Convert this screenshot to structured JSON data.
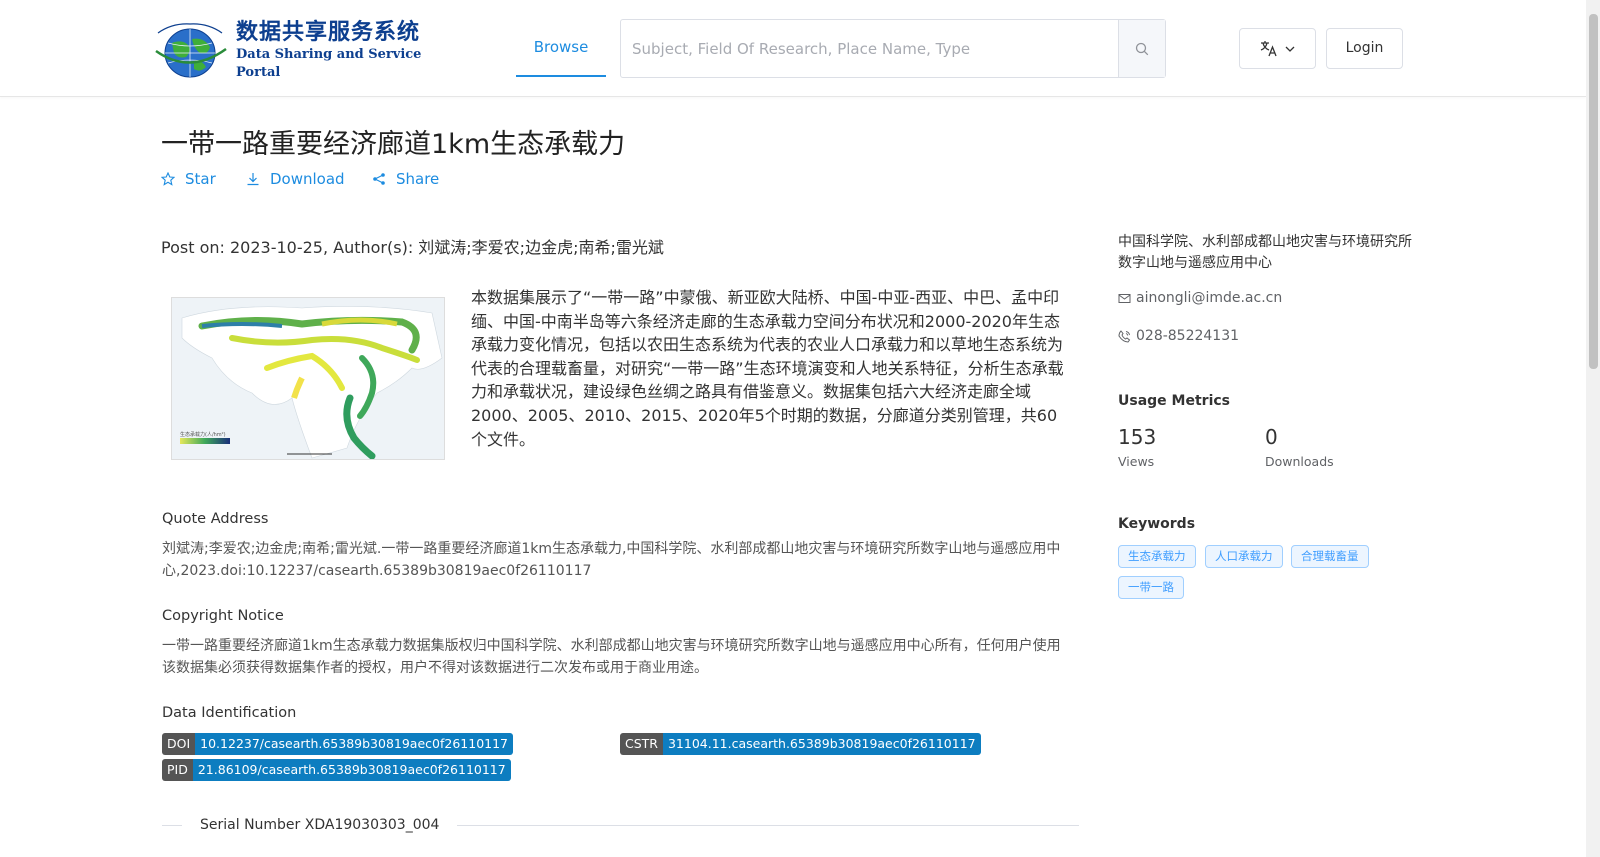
{
  "header": {
    "logo_cn": "数据共享服务系统",
    "logo_en": "Data Sharing and Service Portal",
    "nav_browse": "Browse",
    "search_placeholder": "Subject, Field Of Research, Place Name, Type",
    "login": "Login"
  },
  "dataset": {
    "title": "一带一路重要经济廊道1km生态承载力",
    "actions": {
      "star": "Star",
      "download": "Download",
      "share": "Share"
    },
    "post_meta": "Post on: 2023-10-25, Author(s): 刘斌涛;李爱农;边金虎;南希;雷光斌",
    "description": "本数据集展示了“一带一路”中蒙俄、新亚欧大陆桥、中国-中亚-西亚、中巴、孟中印缅、中国-中南半岛等六条经济走廊的生态承载力空间分布状况和2000-2020年生态承载力变化情况，包括以农田生态系统为代表的农业人口承载力和以草地生态系统为代表的合理载畜量，对研究“一带一路”生态环境演变和人地关系特征，分析生态承载力和承载状况，建设绿色丝绸之路具有借鉴意义。数据集包括六大经济走廊全域2000、2005、2010、2015、2020年5个时期的数据，分廊道分类别管理，共60个文件。",
    "quote_title": "Quote Address",
    "quote_body": "刘斌涛;李爱农;边金虎;南希;雷光斌.一带一路重要经济廊道1km生态承载力,中国科学院、水利部成都山地灾害与环境研究所数字山地与遥感应用中心,2023.doi:10.12237/casearth.65389b30819aec0f26110117",
    "copyright_title": "Copyright Notice",
    "copyright_body": "一带一路重要经济廊道1km生态承载力数据集版权归中国科学院、水利部成都山地灾害与环境研究所数字山地与遥感应用中心所有，任何用户使用该数据集必须获得数据集作者的授权，用户不得对该数据进行二次发布或用于商业用途。",
    "identification_title": "Data Identification",
    "identifiers": {
      "doi_key": "DOI",
      "doi_value": "10.12237/casearth.65389b30819aec0f26110117",
      "cstr_key": "CSTR",
      "cstr_value": "31104.11.casearth.65389b30819aec0f26110117",
      "pid_key": "PID",
      "pid_value": "21.86109/casearth.65389b30819aec0f26110117"
    },
    "serial_number": "Serial Number XDA19030303_004",
    "map_legend_label": "生态承载力(人/hm²)"
  },
  "sidebar": {
    "organization": "中国科学院、水利部成都山地灾害与环境研究所数字山地与遥感应用中心",
    "email": "ainongli@imde.ac.cn",
    "phone": "028-85224131",
    "usage_title": "Usage Metrics",
    "views_value": "153",
    "views_label": "Views",
    "downloads_value": "0",
    "downloads_label": "Downloads",
    "keywords_title": "Keywords",
    "keywords": [
      "生态承载力",
      "人口承载力",
      "合理载畜量",
      "一带一路"
    ]
  },
  "colors": {
    "accent": "#1d8ce0",
    "id_value_bg": "#0d7dc0",
    "id_key_bg": "#555555",
    "logo_blue": "#0d3f8f"
  }
}
